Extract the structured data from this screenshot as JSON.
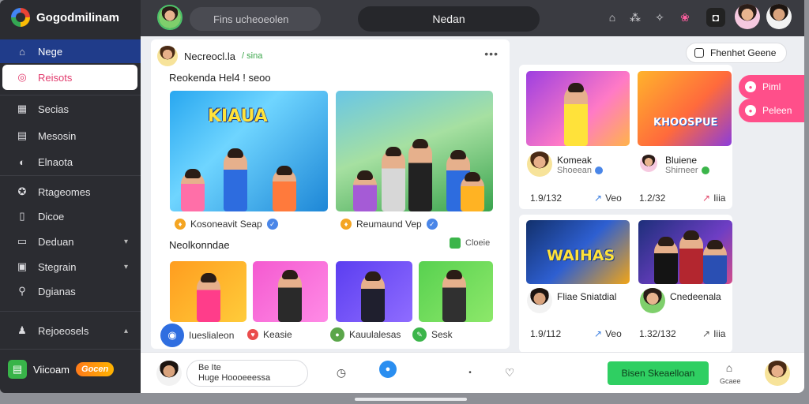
{
  "app": {
    "brand": "Gogodmilinam",
    "colors": {
      "accent_blue": "#203c8a",
      "accent_pink": "#ff4f8a",
      "accent_green": "#2fcf62",
      "sidebar_bg": "#2b2c31"
    }
  },
  "sidebar": {
    "items": [
      {
        "label": "Nege",
        "icon": "home-icon"
      },
      {
        "label": "Reisots",
        "icon": "instagram-icon"
      },
      {
        "label": "Secias",
        "icon": "grid-icon"
      },
      {
        "label": "Mesosin",
        "icon": "message-icon"
      },
      {
        "label": "Elnaota",
        "icon": "shield-icon"
      },
      {
        "label": "Rtageomes",
        "icon": "gamepad-icon"
      },
      {
        "label": "Dicoe",
        "icon": "clip-icon"
      },
      {
        "label": "Deduan",
        "icon": "inbox-icon"
      },
      {
        "label": "Stegrain",
        "icon": "calendar-icon"
      },
      {
        "label": "Dgianas",
        "icon": "location-icon"
      },
      {
        "label": "Rejoeosels",
        "icon": "user-icon"
      }
    ],
    "promo": {
      "label": "Viicoam",
      "badge": "Gocen"
    }
  },
  "topbar": {
    "search_placeholder": "Fins ucheoeolen",
    "center_title": "Nedan"
  },
  "feed": {
    "author": "Necreocl.la",
    "author_tag": "/ sina",
    "section1": "Reokenda Hel4 ! seoo",
    "thumb1_title": "KIAUA",
    "caption1": "Kosoneavit Seap",
    "caption2": "Reumaund Vep",
    "section2": "Neolkonndae",
    "side_tag": "Cloeie",
    "bottom_label1": "Iueslialeon",
    "bottom_label2": "Keasie",
    "bottom_label3": "Kauulalesas",
    "bottom_label4": "Sesk"
  },
  "right": {
    "trend_label": "Fhenhet  Geene",
    "pink1": "Piml",
    "pink2": "Peleen",
    "cards": [
      {
        "name": "Komeak",
        "sub": "Shoeean",
        "views": "1.9/132",
        "shares": "Veo",
        "title": ""
      },
      {
        "name": "Bluiene",
        "sub": "Shirneer",
        "views": "1.2/32",
        "shares": "Iiia",
        "title": "KHOOSPUE"
      },
      {
        "name": "Fliae Sniatdial",
        "sub": "",
        "views": "1.9/112",
        "shares": "Veo",
        "title": "WAIHAS"
      },
      {
        "name": "Cnedeenala",
        "sub": "",
        "views": "1.32/132",
        "shares": "Iiia",
        "title": ""
      }
    ]
  },
  "bottombar": {
    "comment_line1": "Be  Ite",
    "comment_line2": "Huge Hoooeeessa",
    "green_button": "Bisen Skeaelloan",
    "right_label": "Gcaee"
  }
}
